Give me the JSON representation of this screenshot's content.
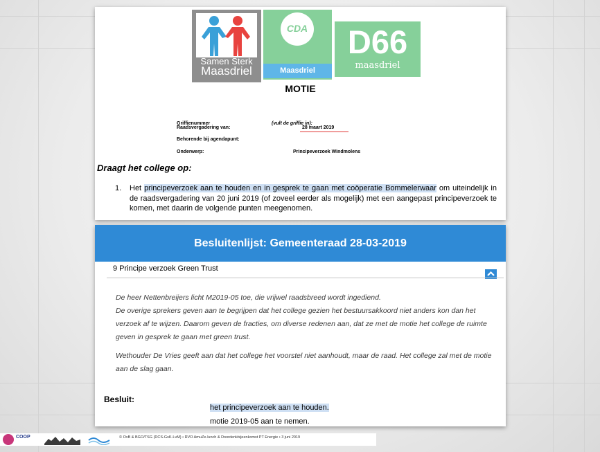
{
  "logos": {
    "samen_sterk_line1": "Samen Sterk",
    "samen_sterk_line2": "Maasdriel",
    "cda_circle": "CDA",
    "cda_band": "Maasdriel",
    "d66_big": "D66",
    "d66_small": "maasdriel"
  },
  "motie": {
    "title": "MOTIE",
    "form": {
      "griffie_label": "Griffienummer",
      "griffie_value": "(vult de griffie in):",
      "raadsvergadering_label": "Raadsvergadering van:",
      "raadsvergadering_value": "28 maart 2019",
      "agendapunt_label": "Behorende bij agendapunt:",
      "onderwerp_label": "Onderwerp:",
      "onderwerp_value": "Principeverzoek Windmolens"
    },
    "draagt_heading": "Draagt het college op:",
    "point_number": "1.",
    "point_part1": "Het ",
    "point_highlight": "principeverzoek aan te houden en in gesprek te gaan met coöperatie Bommelerwaar",
    "point_part2": " om uiteindelijk in de raadsvergadering van 20 juni 2019 (of zoveel eerder als mogelijk) met een aangepast principeverzoek te komen, met daarin de volgende punten meegenomen."
  },
  "besluiten": {
    "header": "Besluitenlijst: Gemeenteraad 28-03-2019",
    "item_title": "9 Principe verzoek Green Trust",
    "para1_line1": "De heer Nettenbreijers licht M2019-05 toe, die vrijwel raadsbreed wordt ingediend.",
    "para1_rest": "De overige sprekers geven aan te begrijpen dat het college gezien het bestuursakkoord niet anders kon dan het verzoek af te wijzen. Daarom geven de fracties, om diverse redenen aan, dat ze met de motie het college de ruimte geven in gesprek te gaan met green trust.",
    "para2": "Wethouder De Vries geeft aan dat het college het voorstel niet aanhoudt, maar de raad. Het college zal met de motie aan de slag gaan.",
    "besluit_label": "Besluit:",
    "besluit_line1": "het principeverzoek aan te houden.",
    "besluit_line2": "motie 2019-05 aan te nemen."
  },
  "footer": {
    "coop_logo": "COOP",
    "text": "© OvB & BGO/TSG (DCS-GsK-LvM) • RVO AmuZe-lunch & Doordenkbijeenkomst PT Energie • 3 juni 2019"
  },
  "colors": {
    "header_blue": "#2f8ad6",
    "logo_green": "#86d09a",
    "highlight": "#cfe0f4",
    "date_underline": "#e0322f"
  }
}
